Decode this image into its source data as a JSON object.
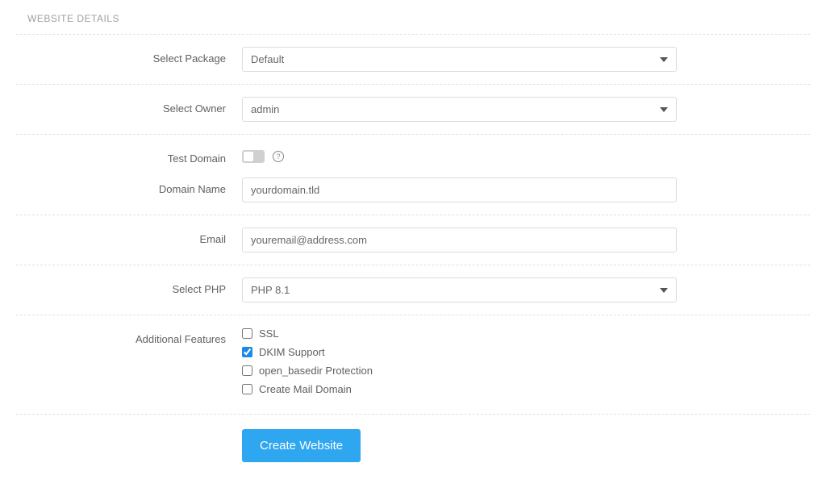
{
  "section_title": "WEBSITE DETAILS",
  "labels": {
    "select_package": "Select Package",
    "select_owner": "Select Owner",
    "test_domain": "Test Domain",
    "domain_name": "Domain Name",
    "email": "Email",
    "select_php": "Select PHP",
    "additional_features": "Additional Features"
  },
  "values": {
    "package": "Default",
    "owner": "admin",
    "domain_name": "yourdomain.tld",
    "email": "youremail@address.com",
    "php": "PHP 8.1",
    "test_domain": false
  },
  "features": {
    "ssl": {
      "label": "SSL",
      "checked": false
    },
    "dkim": {
      "label": "DKIM Support",
      "checked": true
    },
    "open_basedir": {
      "label": "open_basedir Protection",
      "checked": false
    },
    "mail_domain": {
      "label": "Create Mail Domain",
      "checked": false
    }
  },
  "buttons": {
    "submit": "Create Website"
  },
  "help_icon": "?"
}
